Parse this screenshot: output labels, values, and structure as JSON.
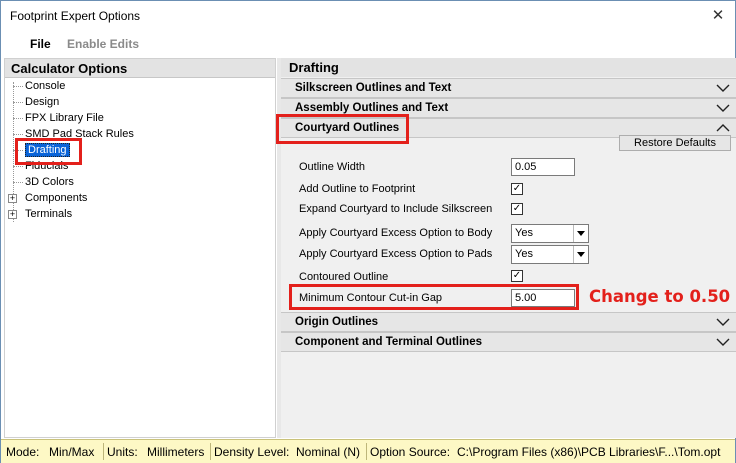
{
  "window": {
    "title": "Footprint Expert Options",
    "close_glyph": "✕"
  },
  "menu": {
    "file": "File",
    "enable_edits": "Enable Edits"
  },
  "left_panel": {
    "header": "Calculator Options",
    "tree": [
      "Console",
      "Design",
      "FPX Library File",
      "SMD Pad Stack Rules",
      "Drafting",
      "Fiducials",
      "3D Colors",
      "Components",
      "Terminals"
    ],
    "expand_glyph": "+"
  },
  "right_panel": {
    "header": "Drafting",
    "sections": {
      "silkscreen": "Silkscreen Outlines and Text",
      "assembly": "Assembly Outlines and Text",
      "courtyard": "Courtyard Outlines",
      "origin": "Origin Outlines",
      "component_terminal": "Component and Terminal Outlines"
    },
    "restore_defaults": "Restore Defaults",
    "rows": {
      "outline_width": {
        "label": "Outline Width",
        "value": "0.05"
      },
      "add_outline": {
        "label": "Add Outline to Footprint",
        "checked": "✓"
      },
      "expand_courtyard": {
        "label": "Expand Courtyard to Include Silkscreen",
        "checked": "✓"
      },
      "excess_body": {
        "label": "Apply Courtyard Excess Option to Body",
        "value": "Yes"
      },
      "excess_pads": {
        "label": "Apply Courtyard Excess Option to Pads",
        "value": "Yes"
      },
      "contoured": {
        "label": "Contoured Outline",
        "checked": "✓"
      },
      "min_gap": {
        "label": "Minimum Contour Cut-in Gap",
        "value": "5.00"
      }
    }
  },
  "annotation": "Change to 0.50",
  "status": {
    "mode_label": "Mode:",
    "mode_value": "Min/Max",
    "units_label": "Units:",
    "units_value": "Millimeters",
    "density_label": "Density Level:",
    "density_value": "Nominal (N)",
    "source_label": "Option Source:",
    "source_value": "C:\\Program Files (x86)\\PCB Libraries\\F...\\Tom.opt"
  },
  "colors": {
    "accent_red": "#e3201b",
    "selection": "#0a64d8",
    "status_bg": "#fdf8c5"
  }
}
